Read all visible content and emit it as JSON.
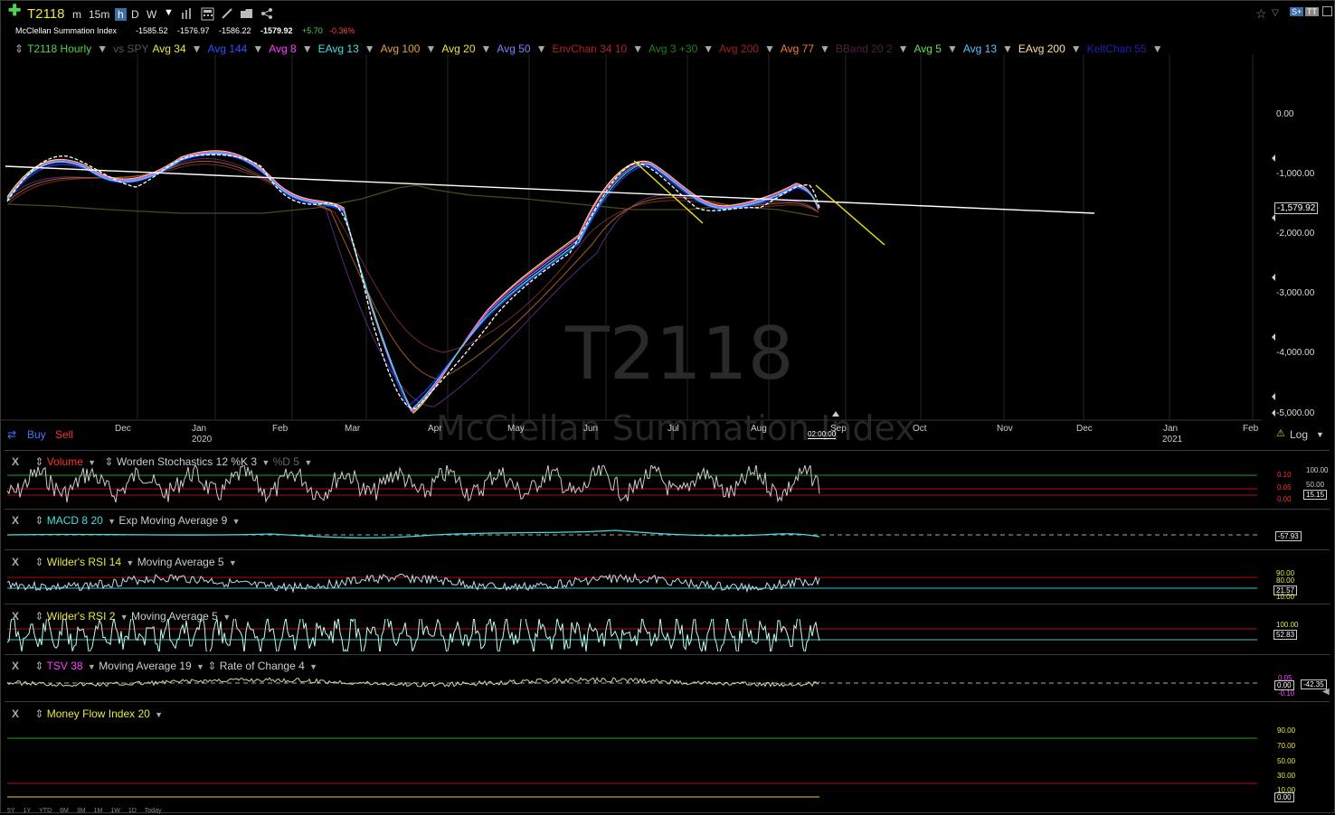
{
  "header": {
    "plus_icon": "plus-icon",
    "symbol": "T2118",
    "timeframes": [
      "m",
      "15m",
      "h",
      "D",
      "W"
    ],
    "active_timeframe": "h",
    "title": "McClellan Summation Index",
    "open": "-1585.52",
    "high": "-1576.97",
    "low": "-1586.22",
    "close": "-1579.92",
    "change": "+5.70",
    "change_pct": "-0.36%"
  },
  "overlays": [
    {
      "label": "T2118 Hourly",
      "color": "#4ed34e"
    },
    {
      "label": "vs SPY",
      "color": "#555555"
    },
    {
      "label": "Avg 34",
      "color": "#e8e840"
    },
    {
      "label": "Avg 144",
      "color": "#3050ff"
    },
    {
      "label": "Avg 8",
      "color": "#ff40ff"
    },
    {
      "label": "EAvg 13",
      "color": "#40e0e0"
    },
    {
      "label": "Avg 100",
      "color": "#e8a040"
    },
    {
      "label": "Avg 20",
      "color": "#f0e040"
    },
    {
      "label": "Avg 50",
      "color": "#8080ff"
    },
    {
      "label": "EnvChan 34 10",
      "color": "#b02020"
    },
    {
      "label": "Avg 3 +30",
      "color": "#208020"
    },
    {
      "label": "Avg 200",
      "color": "#a02020"
    },
    {
      "label": "Avg 77",
      "color": "#f08030"
    },
    {
      "label": "BBand 20 2",
      "color": "#502040"
    },
    {
      "label": "Avg 5",
      "color": "#60e060"
    },
    {
      "label": "Avg 13",
      "color": "#60c0ff"
    },
    {
      "label": "EAvg 200",
      "color": "#ffe0a0"
    },
    {
      "label": "KeltChan 55",
      "color": "#2020b0"
    }
  ],
  "price_axis": [
    "0.00",
    "-1,000.00",
    "-2,000.00",
    "-3,000.00",
    "-4,000.00",
    "-5,000.00"
  ],
  "last_price": "-1,579.92",
  "months": [
    "Dec",
    "Jan",
    "Feb",
    "Mar",
    "Apr",
    "May",
    "Jun",
    "Jul",
    "Aug",
    "Sep",
    "Oct",
    "Nov",
    "Dec",
    "Jan",
    "Feb"
  ],
  "years": [
    "2020",
    "2021"
  ],
  "watermark": {
    "symbol": "T2118",
    "name": "McClellan Summation Index"
  },
  "buy_label": "Buy",
  "sell_label": "Sell",
  "time_label": "02:00:00",
  "log_label": "Log",
  "panels": {
    "p1": {
      "x": "X",
      "name": "Volume",
      "study": "Worden Stochastics 12 %K 3",
      "extra": "%D 5",
      "scale": [
        "100.00",
        "50.00",
        "15.15"
      ],
      "scale2": [
        "0.10",
        "0.05",
        "0.00"
      ]
    },
    "p2": {
      "x": "X",
      "name": "MACD 8 20",
      "study": "Exp Moving Average 9",
      "value": "-57.93"
    },
    "p3": {
      "x": "X",
      "name": "Wilder's RSI 14",
      "study": "Moving Average 5",
      "scale": [
        "90.00",
        "80.00",
        "21.57",
        "10.00"
      ]
    },
    "p4": {
      "x": "X",
      "name": "Wilder's RSI 2",
      "study": "Moving Average 5",
      "scale": [
        "100.00",
        "52.83"
      ]
    },
    "p5": {
      "x": "X",
      "name": "TSV 38",
      "study": "Moving Average 19",
      "study2": "Rate of Change 4",
      "scale": [
        "0.05",
        "0.00",
        "-0.10"
      ],
      "value": "-42.35"
    },
    "p6": {
      "x": "X",
      "name": "Money Flow Index 20",
      "scale": [
        "90.00",
        "70.00",
        "50.00",
        "30.00",
        "10.00",
        "0.00"
      ]
    }
  },
  "range_buttons": [
    "5Y",
    "1Y",
    "YTD",
    "6M",
    "3M",
    "1M",
    "1W",
    "1D",
    "Today"
  ]
}
